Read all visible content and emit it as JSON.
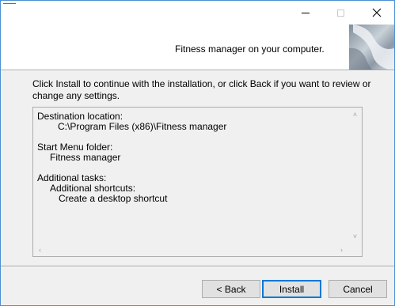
{
  "window": {
    "controls": {
      "minimize": "minimize",
      "maximize": "maximize",
      "close": "close"
    }
  },
  "header": {
    "text": "Fitness manager on your computer."
  },
  "intro": {
    "line1": "Click Install to continue with the installation, or click Back if you want to review or",
    "line2": "change any settings."
  },
  "memo": {
    "destination_label": "Destination location:",
    "destination_value": "C:\\Program Files (x86)\\Fitness manager",
    "start_menu_label": "Start Menu folder:",
    "start_menu_value": "Fitness manager",
    "tasks_label": "Additional tasks:",
    "shortcuts_label": "Additional shortcuts:",
    "shortcut_item": "Create a desktop shortcut"
  },
  "buttons": {
    "back": "< Back",
    "install": "Install",
    "cancel": "Cancel"
  }
}
